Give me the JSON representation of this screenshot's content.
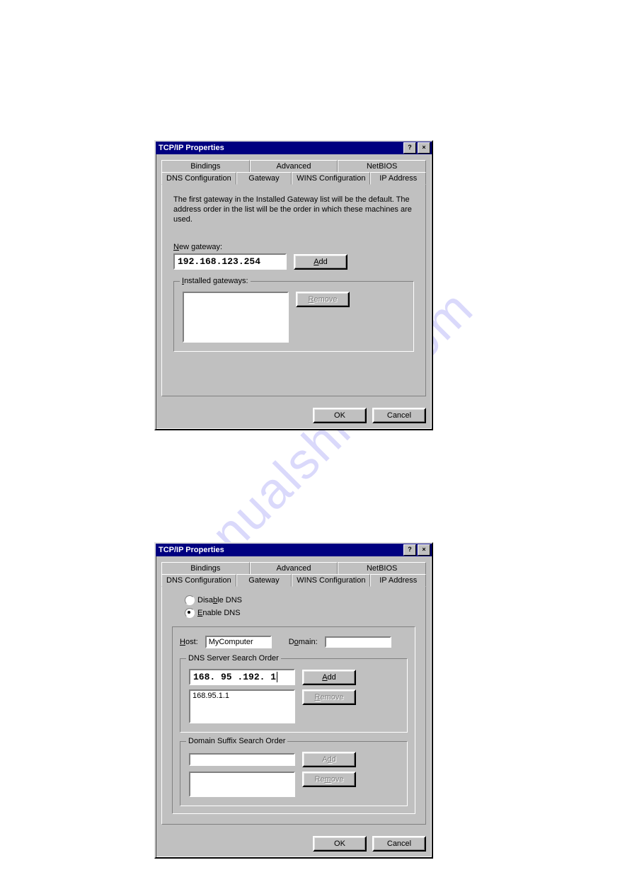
{
  "watermark": "manualshive.com",
  "d1": {
    "title": "TCP/IP Properties",
    "tabs_row1": [
      "Bindings",
      "Advanced",
      "NetBIOS"
    ],
    "tabs_row2": [
      "DNS Configuration",
      "Gateway",
      "WINS Configuration",
      "IP Address"
    ],
    "active_tab": "Gateway",
    "description": "The first gateway in the Installed Gateway list will be the default. The address order in the list will be the order in which these machines are used.",
    "new_gateway_label": "New gateway:",
    "new_gateway_value": "192.168.123.254",
    "add_label": "Add",
    "installed_label": "Installed gateways:",
    "remove_label": "Remove",
    "ok": "OK",
    "cancel": "Cancel",
    "help_btn": "?",
    "close_btn": "×"
  },
  "d2": {
    "title": "TCP/IP Properties",
    "tabs_row1": [
      "Bindings",
      "Advanced",
      "NetBIOS"
    ],
    "tabs_row2": [
      "DNS Configuration",
      "Gateway",
      "WINS Configuration",
      "IP Address"
    ],
    "active_tab": "DNS Configuration",
    "disable_label": "Disable DNS",
    "enable_label": "Enable DNS",
    "host_label": "Host:",
    "host_value": "MyComputer",
    "domain_label": "Domain:",
    "domain_value": "",
    "server_order_label": "DNS Server Search Order",
    "server_input": "168. 95 .192.  1",
    "server_list": "168.95.1.1",
    "suffix_label": "Domain Suffix Search Order",
    "suffix_input": "",
    "add_label": "Add",
    "remove_label": "Remove",
    "ok": "OK",
    "cancel": "Cancel",
    "help_btn": "?",
    "close_btn": "×"
  }
}
